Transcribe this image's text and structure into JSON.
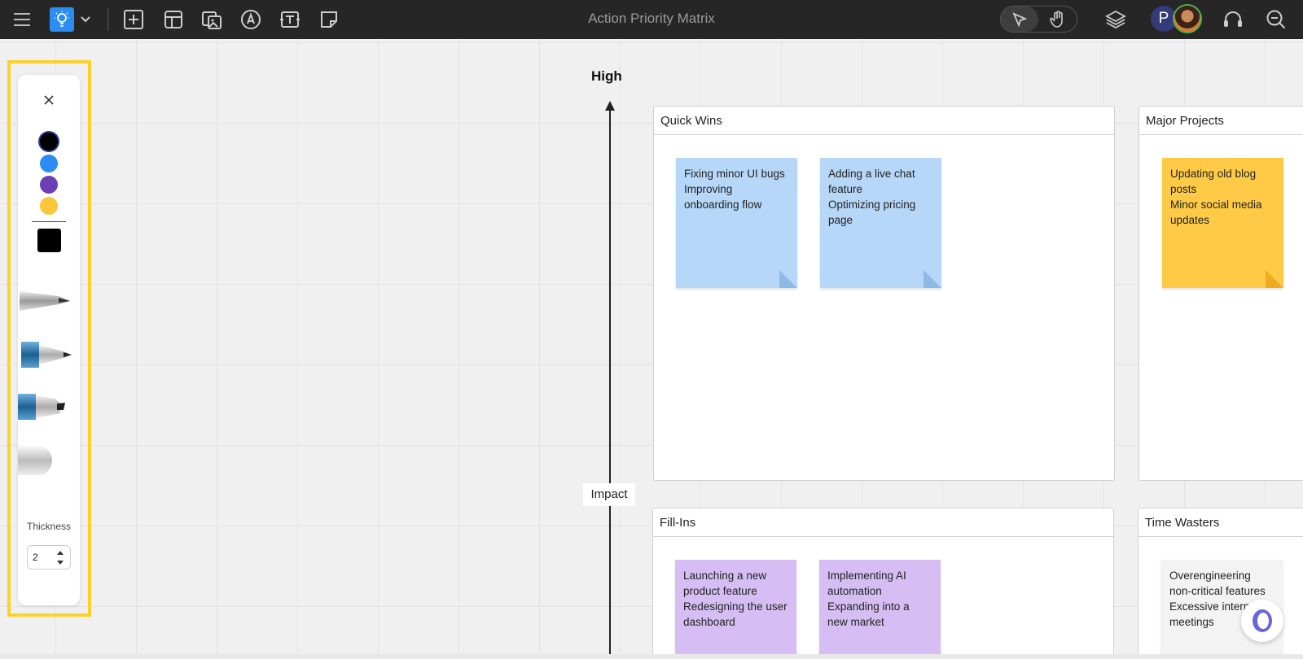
{
  "window": {
    "title": "Action Priority Matrix"
  },
  "toolbar": {
    "icons": [
      "menu-icon",
      "lightbulb-icon",
      "chevron-down-icon",
      "add-square-icon",
      "template-icon",
      "media-icon",
      "pen-icon",
      "text-icon",
      "sticky-note-icon"
    ],
    "right_icons": [
      "select-icon",
      "hand-icon",
      "layers-icon",
      "headset-icon",
      "zoom-out-icon"
    ],
    "avatar_initial": "P",
    "accent": "#2b8cf2"
  },
  "pen_panel": {
    "colors": [
      "#000000",
      "#2b8cf2",
      "#6c3fb5",
      "#fbc63a"
    ],
    "selected_color": "#000000",
    "tools": [
      "fine-pen-icon",
      "marker-icon",
      "highlighter-icon",
      "eraser-icon"
    ],
    "thickness_label": "Thickness",
    "thickness_value": "2",
    "highlight_color": "#fcd12b"
  },
  "axis": {
    "high_label": "High",
    "impact_label": "Impact"
  },
  "quadrants": {
    "quick_wins": {
      "title": "Quick Wins",
      "notes": [
        {
          "lines": [
            "Fixing minor UI bugs",
            "Improving onboarding flow"
          ]
        },
        {
          "lines": [
            "Adding a live chat feature",
            "Optimizing pricing page"
          ]
        }
      ]
    },
    "major_projects": {
      "title": "Major Projects",
      "notes": [
        {
          "lines": [
            "Updating old blog posts",
            "Minor social media updates"
          ]
        }
      ]
    },
    "fill_ins": {
      "title": "Fill-Ins",
      "notes": [
        {
          "lines": [
            "Launching a new product feature",
            "Redesigning the user dashboard"
          ]
        },
        {
          "lines": [
            "Implementing AI automation",
            "Expanding into a new market"
          ]
        }
      ]
    },
    "time_wasters": {
      "title": "Time Wasters",
      "notes": [
        {
          "lines": [
            "Overengineering non-critical features",
            "Excessive internal meetings"
          ]
        }
      ]
    }
  }
}
